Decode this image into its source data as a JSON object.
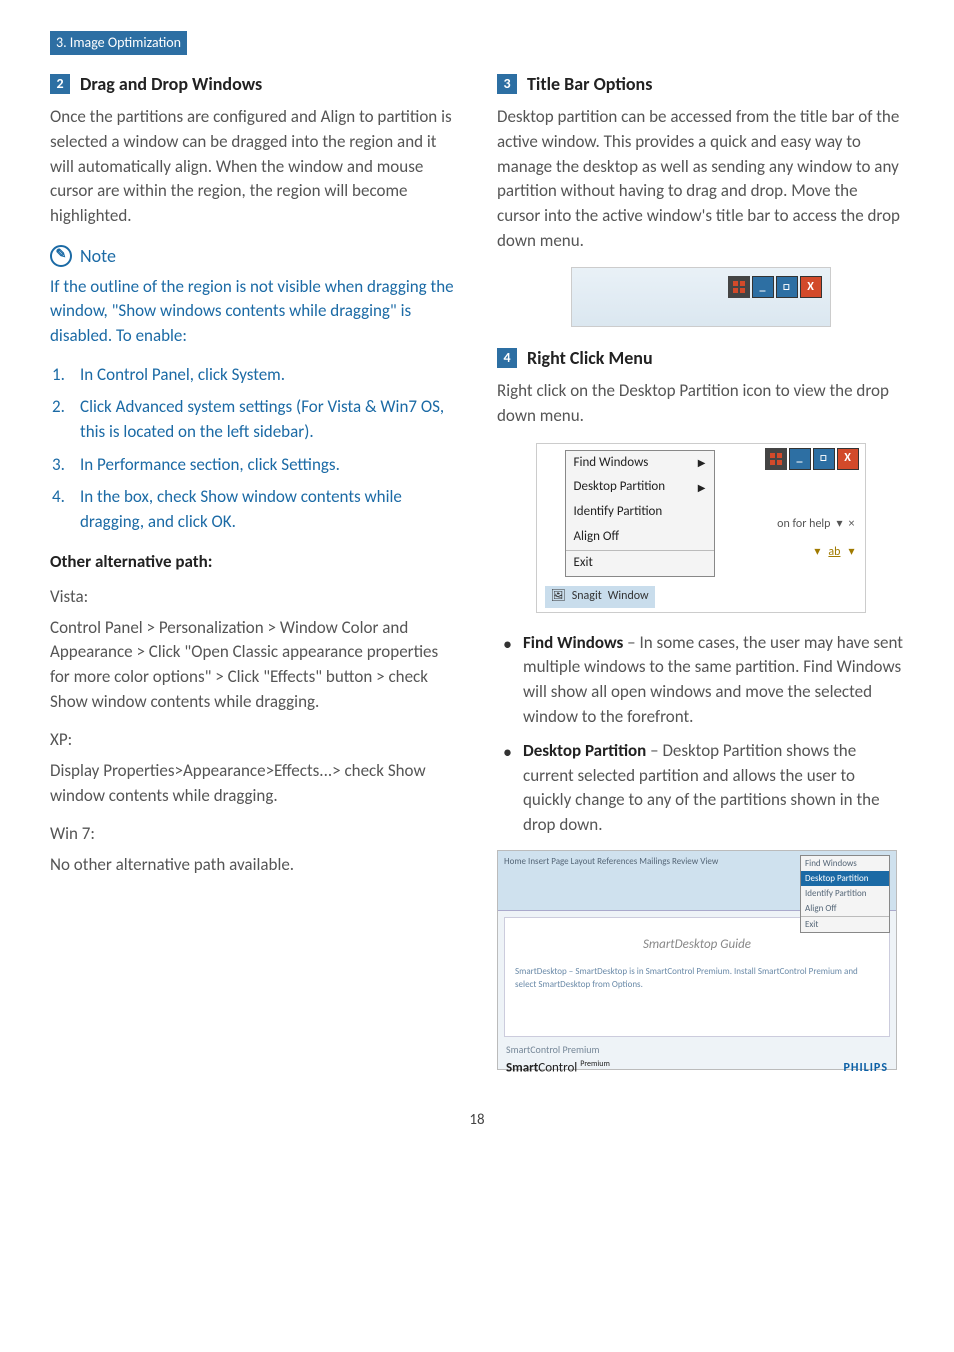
{
  "header": "3. Image Optimization",
  "left": {
    "sec2_num": "2",
    "sec2_title": "Drag and Drop Windows",
    "sec2_body": "Once the partitions are configured and Align to partition is selected a window can be dragged into the region and it will automatically align. When the window and mouse cursor are within the region, the region will become highlighted.",
    "note_label": "Note",
    "note_body": "If the outline of the region is not visible when dragging the window, \"Show windows contents while dragging\" is disabled.  To enable:",
    "steps": [
      "In Control Panel, click System.",
      "Click Advanced system settings  (For Vista & Win7 OS, this is located on the left sidebar).",
      "In Performance section, click Settings.",
      "In the box, check Show window contents while dragging, and click OK."
    ],
    "alt_heading": "Other alternative path:",
    "vista_label": "Vista:",
    "vista_body": "Control Panel > Personalization > Window Color and Appearance > Click \"Open Classic appearance properties for more color options\" > Click \"Effects\" button > check Show window contents while dragging.",
    "xp_label": "XP:",
    "xp_body": "Display Properties>Appearance>Effects...> check Show window contents while dragging.",
    "win7_label": "Win 7:",
    "win7_body": "No other alternative path available."
  },
  "right": {
    "sec3_num": "3",
    "sec3_title": "Title Bar Options",
    "sec3_body": "Desktop partition can be accessed from the title bar of the active window.  This provides a quick and easy way to manage the desktop as well as sending any window to any partition without having to drag and drop.  Move the cursor into the active window's title bar to access the drop down menu.",
    "sec4_num": "4",
    "sec4_title": "Right Click Menu",
    "sec4_body": "Right click on the Desktop Partition icon to view the drop down menu.",
    "menu_items": {
      "m1": "Find Windows",
      "m2": "Desktop Partition",
      "m3": "Identify Partition",
      "m4": "Align Off",
      "m5": "Exit"
    },
    "help_text": "on for help",
    "ab_text": "ab",
    "taskbar_snagit": "Snagit",
    "taskbar_window": "Window",
    "bullets": [
      {
        "lead": "Find Windows",
        "rest": " – In some cases, the user may have sent multiple windows to the same partition.  Find Windows will show all open windows and move the selected window to the forefront."
      },
      {
        "lead": "Desktop Partition",
        "rest": " – Desktop Partition shows the current selected partition and allows the user to quickly change to any of the partitions shown in the drop down."
      }
    ],
    "word_ribbon_tabs": "Home   Insert   Page Layout   References   Mailings   Review   View",
    "word_doc_title": "SmartDesktop Guide",
    "word_doc_line": "SmartDesktop – SmartDesktop is in SmartControl Premium.  Install SmartControl Premium and select SmartDesktop from Options.",
    "word_sc_bar": "SmartControl Premium",
    "word_sc_label1": "Smart",
    "word_sc_label2": "Control",
    "word_sc_sup": "Premium",
    "word_brand": "PHILIPS",
    "word_side_menu": {
      "a": "Find Windows",
      "b": "Desktop Partition",
      "c": "Identify Partition",
      "d": "Align Off",
      "e": "Exit"
    }
  },
  "page_number": "18"
}
